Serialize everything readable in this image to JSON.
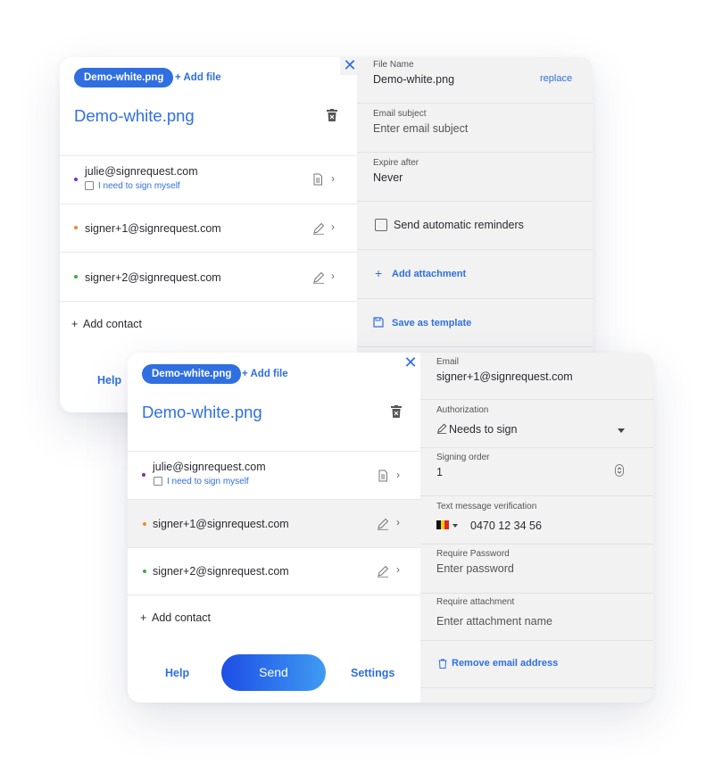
{
  "back_card": {
    "file_chip": "Demo-white.png",
    "add_file": "+ Add file",
    "doc_title": "Demo-white.png",
    "signers": [
      {
        "email": "julie@signrequest.com",
        "sign_myself": "I need to sign myself",
        "dot_color": "#7b2fbf",
        "icon": "document-icon"
      },
      {
        "email": "signer+1@signrequest.com",
        "dot_color": "#f08a24",
        "icon": "pen-icon"
      },
      {
        "email": "signer+2@signrequest.com",
        "dot_color": "#3aab4a",
        "icon": "pen-icon"
      }
    ],
    "add_contact": "Add contact",
    "help": "Help",
    "settings": {
      "file_name_label": "File Name",
      "file_name_value": "Demo-white.png",
      "replace": "replace",
      "email_subject_label": "Email subject",
      "email_subject_placeholder": "Enter email subject",
      "expire_label": "Expire after",
      "expire_value": "Never",
      "reminders": "Send automatic reminders",
      "add_attachment": "Add attachment",
      "save_template": "Save as template"
    }
  },
  "front_card": {
    "file_chip": "Demo-white.png",
    "add_file": "+ Add file",
    "doc_title": "Demo-white.png",
    "signers": [
      {
        "email": "julie@signrequest.com",
        "sign_myself": "I need to sign myself",
        "dot_color": "#7b2fbf",
        "icon": "document-icon"
      },
      {
        "email": "signer+1@signrequest.com",
        "dot_color": "#f08a24",
        "icon": "pen-icon"
      },
      {
        "email": "signer+2@signrequest.com",
        "dot_color": "#3aab4a",
        "icon": "pen-icon"
      }
    ],
    "add_contact": "Add contact",
    "help": "Help",
    "send": "Send",
    "settings_link": "Settings",
    "signer_details": {
      "email_label": "Email",
      "email_value": "signer+1@signrequest.com",
      "authorization_label": "Authorization",
      "authorization_value": "Needs to sign",
      "signing_order_label": "Signing order",
      "signing_order_value": "1",
      "sms_label": "Text message verification",
      "phone_value": "0470 12 34 56",
      "password_label": "Require Password",
      "password_placeholder": "Enter password",
      "attachment_label": "Require attachment",
      "attachment_placeholder": "Enter attachment name",
      "remove_email": "Remove email address"
    }
  },
  "colors": {
    "accent": "#2f6fe0",
    "panel_bg": "#f2f2f2"
  }
}
